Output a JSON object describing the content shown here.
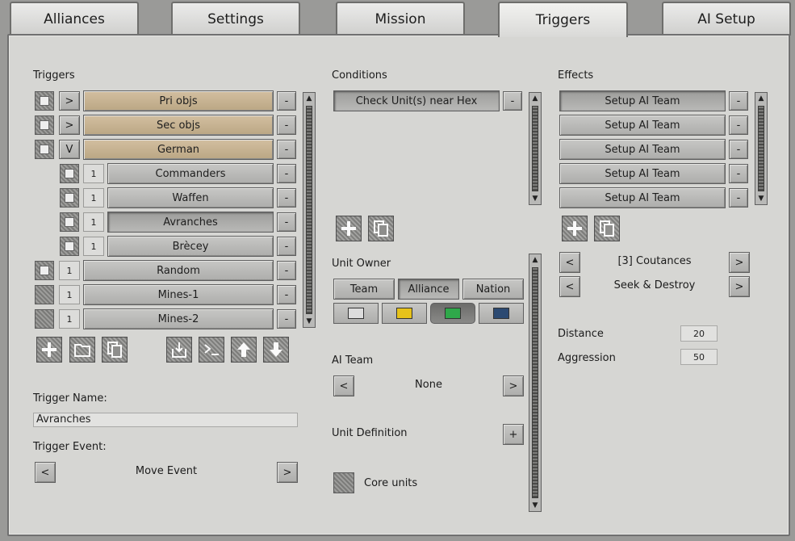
{
  "tabs": [
    "Alliances",
    "Settings",
    "Mission",
    "Triggers",
    "AI Setup"
  ],
  "triggers": {
    "heading": "Triggers",
    "rows": [
      {
        "toggle": ">",
        "label": "Pri objs",
        "remove": "-"
      },
      {
        "toggle": ">",
        "label": "Sec objs",
        "remove": "-"
      },
      {
        "toggle": "V",
        "label": "German",
        "remove": "-"
      },
      {
        "toggle": "1",
        "label": "Commanders",
        "remove": "-"
      },
      {
        "toggle": "1",
        "label": "Waffen",
        "remove": "-"
      },
      {
        "toggle": "1",
        "label": "Avranches",
        "remove": "-"
      },
      {
        "toggle": "1",
        "label": "Brècey",
        "remove": "-"
      },
      {
        "toggle": "1",
        "label": "Random",
        "remove": "-"
      },
      {
        "toggle": "1",
        "label": "Mines-1",
        "remove": "-"
      },
      {
        "toggle": "1",
        "label": "Mines-2",
        "remove": "-"
      }
    ],
    "name_label": "Trigger Name:",
    "name_value": "Avranches",
    "event_label": "Trigger Event:",
    "event_value": "Move Event",
    "prev": "<",
    "next": ">"
  },
  "conditions": {
    "heading": "Conditions",
    "items": [
      {
        "label": "Check Unit(s) near Hex",
        "remove": "-"
      }
    ],
    "unit_owner_label": "Unit Owner",
    "owner_tabs": [
      "Team",
      "Alliance",
      "Nation"
    ],
    "colors": [
      "#dcdcdc",
      "#e6c21a",
      "#2fa84a",
      "#2c4a72"
    ],
    "ai_team_label": "AI Team",
    "ai_team_value": "None",
    "unit_definition_label": "Unit Definition",
    "add": "+",
    "core_units_label": "Core units",
    "prev": "<",
    "next": ">"
  },
  "effects": {
    "heading": "Effects",
    "items": [
      {
        "label": "Setup AI Team",
        "remove": "-"
      },
      {
        "label": "Setup AI Team",
        "remove": "-"
      },
      {
        "label": "Setup AI Team",
        "remove": "-"
      },
      {
        "label": "Setup AI Team",
        "remove": "-"
      },
      {
        "label": "Setup AI Team",
        "remove": "-"
      }
    ],
    "target_value": "[3] Coutances",
    "mode_value": "Seek & Destroy",
    "distance_label": "Distance",
    "distance_value": "20",
    "aggression_label": "Aggression",
    "aggression_value": "50",
    "prev": "<",
    "next": ">"
  },
  "icons": {
    "add": "plus-icon",
    "folder": "folder-icon",
    "copy": "copy-icon",
    "import": "import-icon",
    "console": "console-icon",
    "up": "arrow-up-icon",
    "down": "arrow-down-icon"
  }
}
